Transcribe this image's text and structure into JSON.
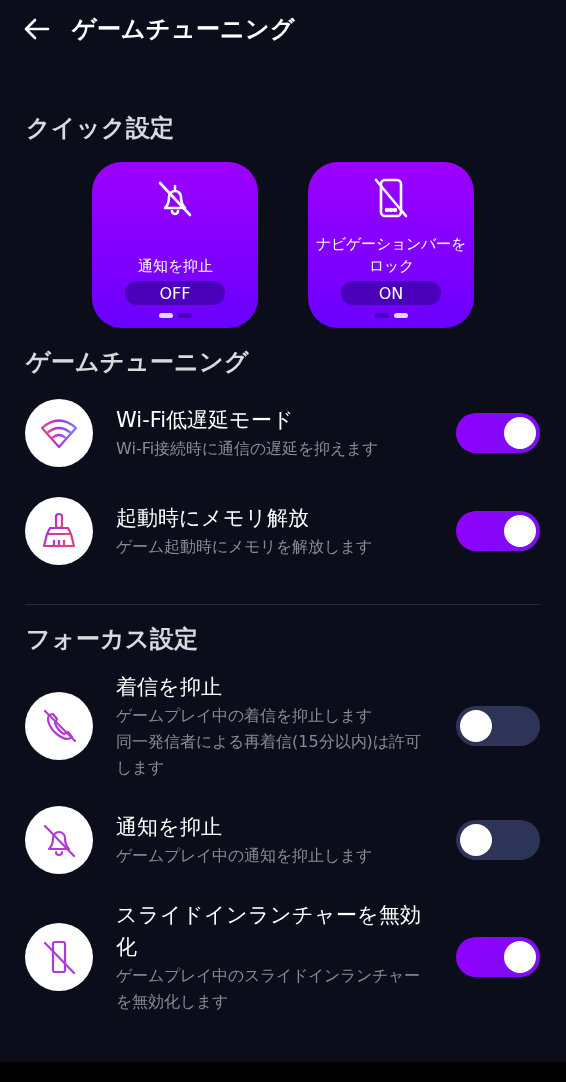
{
  "header": {
    "title": "ゲームチューニング"
  },
  "quick_settings": {
    "title": "クイック設定",
    "tiles": [
      {
        "kind": "bell-off",
        "label": "通知を抑止",
        "state": "OFF",
        "pages": [
          {
            "selected": true
          },
          {
            "selected": false
          }
        ]
      },
      {
        "kind": "phone-off",
        "label": "ナビゲーションバーをロック",
        "state": "ON",
        "pages": [
          {
            "selected": false
          },
          {
            "selected": true
          }
        ]
      }
    ]
  },
  "sections": [
    {
      "title": "ゲームチューニング",
      "items": [
        {
          "kind": "wifi",
          "title": "Wi-Fi低遅延モード",
          "description": [
            "Wi-Fi接続時に通信の遅延を抑えます"
          ],
          "on": true
        },
        {
          "kind": "broom",
          "title": "起動時にメモリ解放",
          "description": [
            "ゲーム起動時にメモリを解放します"
          ],
          "on": true
        }
      ]
    },
    {
      "title": "フォーカス設定",
      "items": [
        {
          "kind": "call-off",
          "title": "着信を抑止",
          "description": [
            "ゲームプレイ中の着信を抑止します",
            "同一発信者による再着信(15分以内)は許可します"
          ],
          "on": false
        },
        {
          "kind": "bell-off",
          "title": "通知を抑止",
          "description": [
            "ゲームプレイ中の通知を抑止します"
          ],
          "on": false
        },
        {
          "kind": "phone-off",
          "title": "スライドインランチャーを無効化",
          "description": [
            "ゲームプレイ中のスライドインランチャーを無効化します"
          ],
          "on": true
        }
      ]
    }
  ]
}
